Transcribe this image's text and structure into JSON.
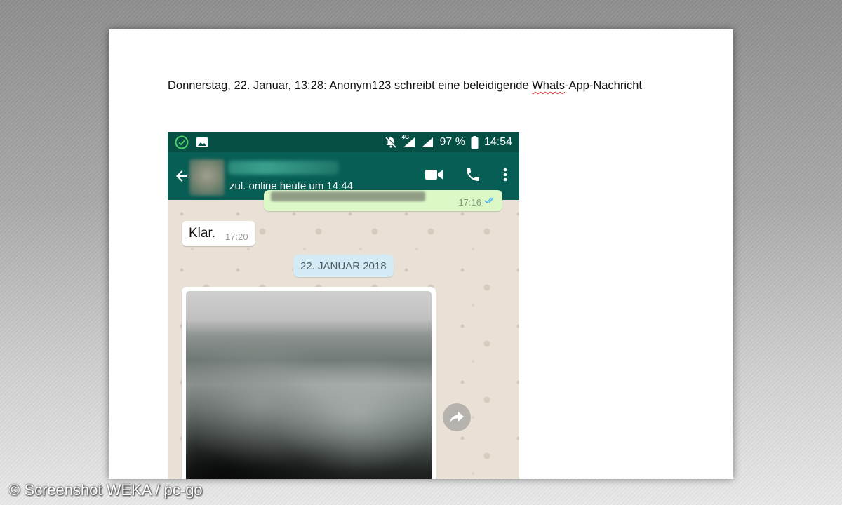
{
  "document": {
    "caption_before": "Donnerstag, 22. Januar, 13:28: Anonym123 schreibt eine beleidigende ",
    "caption_underlined": "Whats",
    "caption_after": "-App-Nachricht"
  },
  "statusbar": {
    "network": "4G",
    "battery": "97 %",
    "time": "14:54",
    "icons": [
      "check-circle-icon",
      "image-icon",
      "bell-off-icon",
      "signal-icon",
      "signal-icon",
      "battery-icon"
    ]
  },
  "appbar": {
    "last_seen": "zul. online heute um 14:44",
    "icons": [
      "back-arrow-icon",
      "video-call-icon",
      "phone-icon",
      "more-vert-icon"
    ]
  },
  "chat": {
    "outgoing_time": "17:16",
    "incoming_text": "Klar.",
    "incoming_time": "17:20",
    "date_chip": "22. JANUAR 2018"
  },
  "credit": "© Screenshot WEKA / pc-go",
  "colors": {
    "status_bar": "#054f45",
    "app_bar": "#075e54",
    "outgoing_bubble": "#dcf8c6",
    "date_chip": "#d4eaf4"
  }
}
